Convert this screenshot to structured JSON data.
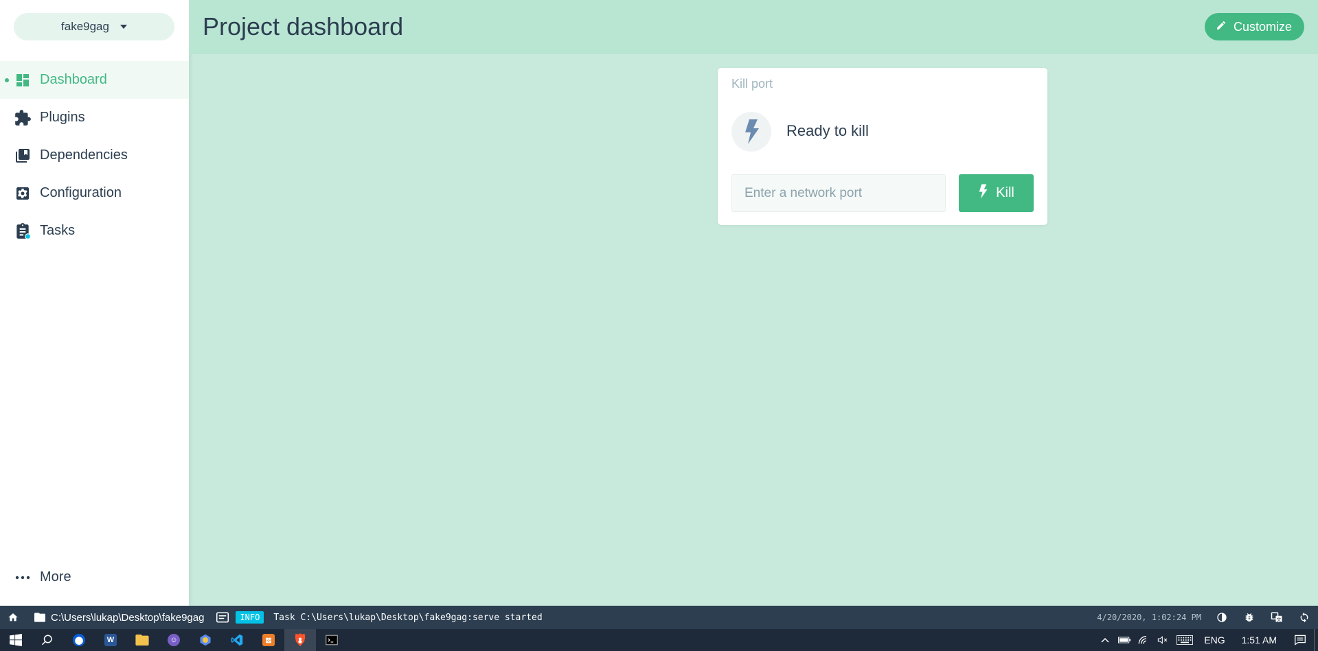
{
  "sidebar": {
    "project_name": "fake9gag",
    "items": [
      {
        "label": "Dashboard",
        "icon": "dashboard-icon",
        "active": true
      },
      {
        "label": "Plugins",
        "icon": "puzzle-icon",
        "active": false
      },
      {
        "label": "Dependencies",
        "icon": "library-icon",
        "active": false
      },
      {
        "label": "Configuration",
        "icon": "settings-icon",
        "active": false
      },
      {
        "label": "Tasks",
        "icon": "clipboard-icon",
        "active": false
      }
    ],
    "more_label": "More"
  },
  "header": {
    "title": "Project dashboard",
    "customize_label": "Customize"
  },
  "widget": {
    "title": "Kill port",
    "status": "Ready to kill",
    "input_placeholder": "Enter a network port",
    "input_value": "",
    "button_label": "Kill"
  },
  "statusbar": {
    "path": "C:\\Users\\lukap\\Desktop\\fake9gag",
    "log_level": "INFO",
    "log_message": "Task C:\\Users\\lukap\\Desktop\\fake9gag:serve started",
    "timestamp": "4/20/2020, 1:02:24 PM"
  },
  "taskbar": {
    "language": "ENG",
    "clock": "1:51 AM"
  },
  "colors": {
    "accent": "#42b983",
    "background": "#c8eadc",
    "header": "#b9e5d3",
    "statusbar": "#2c3e50",
    "badge_info": "#03c2e6"
  }
}
